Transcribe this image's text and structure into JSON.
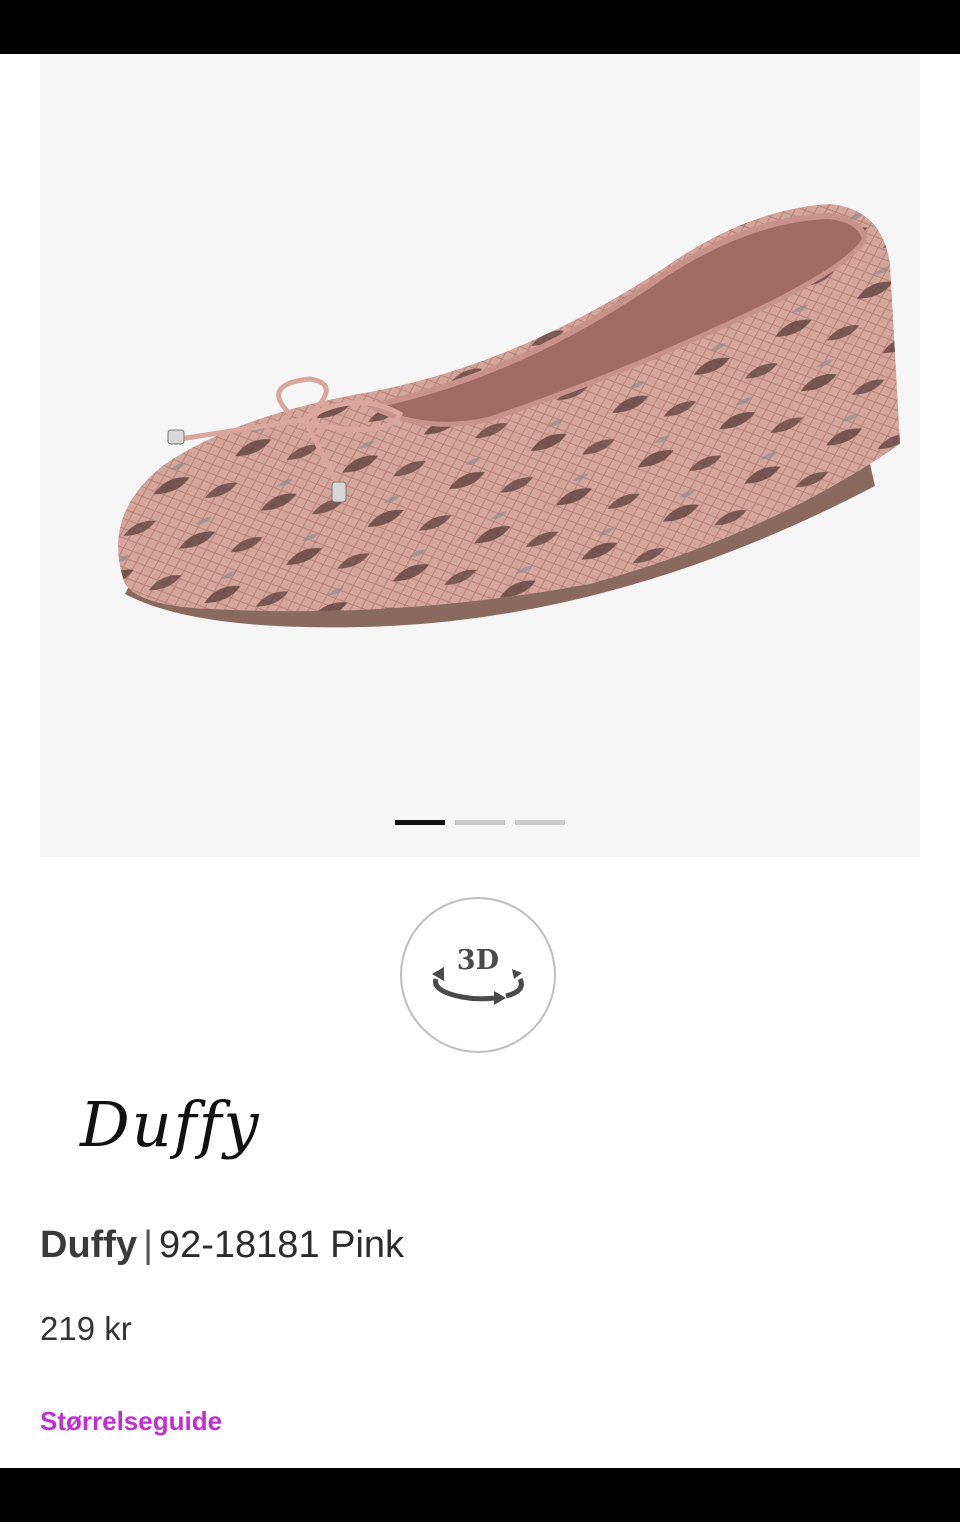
{
  "product": {
    "brand": "Duffy",
    "separator": "|",
    "name": "92-18181 Pink",
    "price": "219 kr"
  },
  "brand_logo": {
    "text": "Duffy"
  },
  "gallery": {
    "image_alt": "pink snake-print ballet flat with bow",
    "slides": 3,
    "active_slide": 1
  },
  "viewer_3d": {
    "label": "3D",
    "icon": "rotate-360-icon"
  },
  "links": {
    "size_guide": "Størrelseguide"
  },
  "colors": {
    "link": "#c12ed1",
    "gallery_bg": "#f6f6f6",
    "shoe_body": "#c99a90"
  }
}
